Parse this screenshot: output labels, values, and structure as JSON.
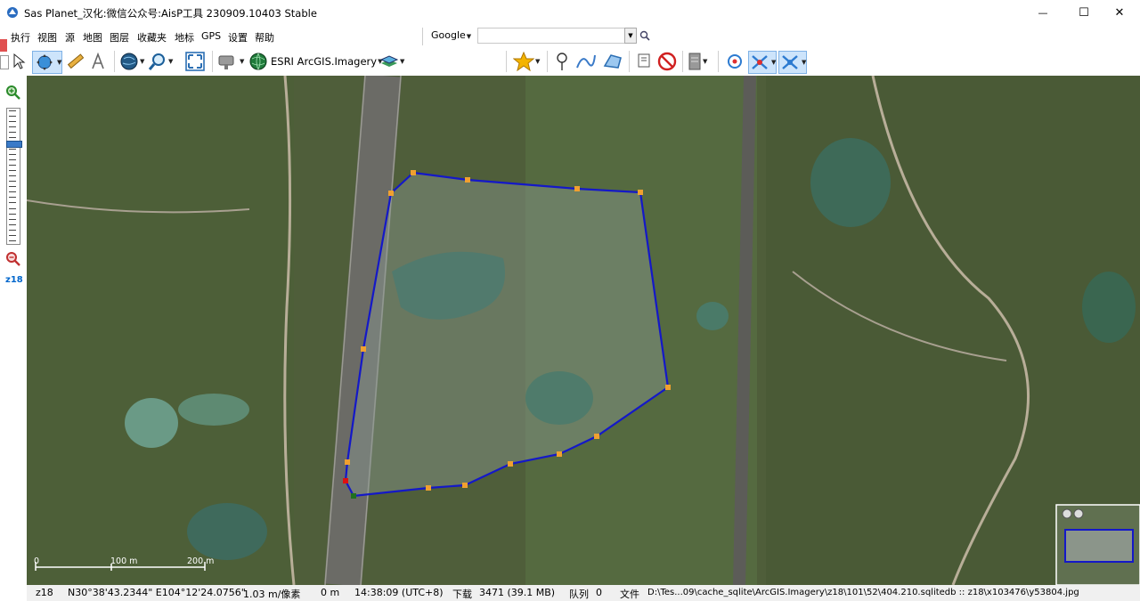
{
  "window": {
    "title": "Sas Planet_汉化:微信公众号:AisP工具 230909.10403 Stable",
    "minimize": "—",
    "maximize": "☐",
    "close": "✕"
  },
  "menu": {
    "items": [
      "执行",
      "视图",
      "源",
      "地图",
      "图层",
      "收藏夹",
      "地标",
      "GPS",
      "设置",
      "帮助"
    ],
    "search_engine": "Google",
    "search_placeholder": ""
  },
  "toolbar": {
    "map_source": "ESRI ArcGIS.Imagery",
    "icons": [
      "cursor-icon",
      "move-icon",
      "ruler-icon",
      "path-icon",
      "globe-icon",
      "zoom-icon",
      "fullscreen-icon",
      "satellite-icon",
      "esri-globe-icon",
      "layers-icon",
      "favorite-star-icon",
      "placemark-icon",
      "polyline-icon",
      "polygon-icon",
      "delete-mark-icon",
      "hide-mark-icon",
      "cache-icon",
      "gps-icon",
      "gps-track-icon",
      "gps-center-icon"
    ]
  },
  "left_panel": {
    "zoom_label": "z18",
    "zoom_level": 18,
    "zoom_max": 24
  },
  "scale": {
    "ticks": [
      "0",
      "100 m",
      "200 m"
    ]
  },
  "status": {
    "zoom": "z18",
    "coords": "N30°38'43.2344\" E104°12'24.0756\"",
    "resolution": "1.03 m/像素",
    "distance": "0 m",
    "time": "14:38:09 (UTC+8)",
    "download_label": "下载",
    "download_value": "3471 (39.1 MB)",
    "queue_label": "队列",
    "queue_value": "0",
    "file_label": "文件",
    "file_path": "D:\\Tes...09\\cache_sqlite\\ArcGIS.Imagery\\z18\\101\\52\\404.210.sqlitedb :: z18\\x103476\\y53804.jpg"
  },
  "colors": {
    "polygon_stroke": "#1418c8",
    "vertex": "#f0a030",
    "start_vertex": "#e01010",
    "end_vertex": "#207020",
    "accent": "#0066cc"
  }
}
